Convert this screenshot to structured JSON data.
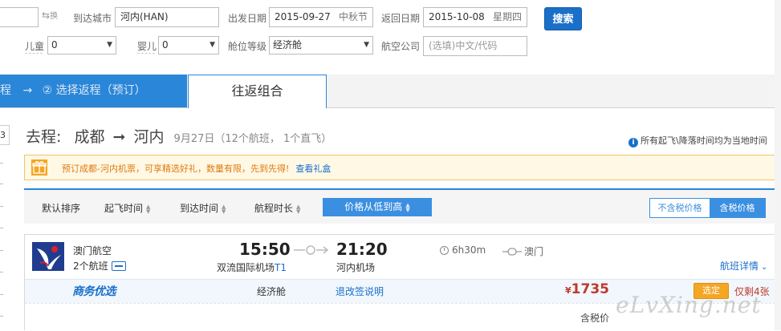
{
  "search": {
    "to_label": "到达城市",
    "to_value": "河内(HAN)",
    "swap_label": "换",
    "depart_label": "出发日期",
    "depart_value": "2015-09-27",
    "depart_hint": "中秋节",
    "return_label": "返回日期",
    "return_value": "2015-10-08",
    "return_hint": "星期四",
    "search_button": "搜索",
    "child_label": "儿童",
    "child_value": "0",
    "infant_label": "婴儿",
    "infant_value": "0",
    "cabin_label": "舱位等级",
    "cabin_value": "经济舱",
    "airline_label": "航空公司",
    "airline_placeholder": "(选填)中文/代码"
  },
  "steps": {
    "step1_tail": "程",
    "arrow": "→",
    "step2": "② 选择返程（预订）",
    "combo_tab": "往返组合"
  },
  "left_stub": "3",
  "route": {
    "prefix": "去程:",
    "from": "成都",
    "arrow": "➞",
    "to": "河内",
    "date_info": "9月27日（12个航班， 1个直飞）"
  },
  "timezone_note": "所有起飞\\降落时间均为当地时间",
  "promo": {
    "text": "预订成都-河内机票，可享精选好礼，数量有限，先到先得!",
    "link": "查看礼盒"
  },
  "sort": {
    "default": "默认排序",
    "depart_time": "起飞时间",
    "arrive_time": "到达时间",
    "duration": "航程时长",
    "price": "价格从低到高",
    "tax_excluded": "不含税价格",
    "tax_included": "含税价格"
  },
  "flight": {
    "airline": "澳门航空",
    "sub_flights": "2个航班",
    "dep_time": "15:50",
    "arr_time": "21:20",
    "dep_airport": "双流国际机场",
    "dep_terminal": "T1",
    "arr_airport": "河内机场",
    "duration": "6h30m",
    "stop": "澳门",
    "details_link": "航班详情",
    "badge": "商务优选",
    "cabin": "经济舱",
    "refund_link": "退改签说明",
    "currency": "¥",
    "price": "1735",
    "choose_button": "选定",
    "remaining": "仅剩4张",
    "tax_note": "含税价"
  },
  "watermark": "eLvXing.net",
  "colors": {
    "primary": "#2a86d8",
    "link": "#1a6fc9",
    "price": "#c0392b",
    "promo_text": "#e07a10",
    "choose": "#f5a623"
  }
}
